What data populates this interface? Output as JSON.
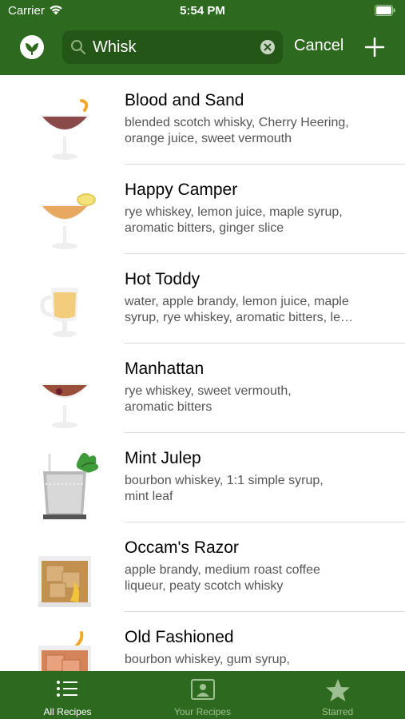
{
  "status_bar": {
    "carrier": "Carrier",
    "time": "5:54 PM"
  },
  "search": {
    "query": "Whisk"
  },
  "header": {
    "cancel_label": "Cancel"
  },
  "recipes": [
    {
      "title": "Blood and Sand",
      "ingredients_line1": "blended scotch whisky, Cherry Heering,",
      "ingredients_line2": "orange juice, sweet vermouth",
      "glass": "coupe"
    },
    {
      "title": "Happy Camper",
      "ingredients_line1": "rye whiskey, lemon juice, maple syrup,",
      "ingredients_line2": "aromatic bitters, ginger slice",
      "glass": "coupe"
    },
    {
      "title": "Hot Toddy",
      "ingredients_line1": "water, apple brandy, lemon juice, maple",
      "ingredients_line2": "syrup, rye whiskey, aromatic bitters, le…",
      "glass": "irish-coffee-mug"
    },
    {
      "title": "Manhattan",
      "ingredients_line1": "rye whiskey, sweet vermouth,",
      "ingredients_line2": "aromatic bitters",
      "glass": "coupe"
    },
    {
      "title": "Mint Julep",
      "ingredients_line1": "bourbon whiskey, 1:1 simple syrup,",
      "ingredients_line2": "mint leaf",
      "glass": "julep-cup"
    },
    {
      "title": "Occam's Razor",
      "ingredients_line1": "apple brandy, medium roast coffee",
      "ingredients_line2": "liqueur, peaty scotch whisky",
      "glass": "rocks"
    },
    {
      "title": "Old Fashioned",
      "ingredients_line1": "bourbon whiskey, gum syrup,",
      "ingredients_line2": "",
      "glass": "rocks"
    }
  ],
  "tabbar": {
    "tabs": [
      {
        "label": "All Recipes",
        "icon": "list-icon",
        "active": true
      },
      {
        "label": "Your Recipes",
        "icon": "user-card-icon",
        "active": false
      },
      {
        "label": "Starred",
        "icon": "star-icon",
        "active": false
      }
    ]
  },
  "colors": {
    "brand_green": "#2d6a1f",
    "search_field": "#245617",
    "inactive_tab": "#9ebf8f"
  }
}
